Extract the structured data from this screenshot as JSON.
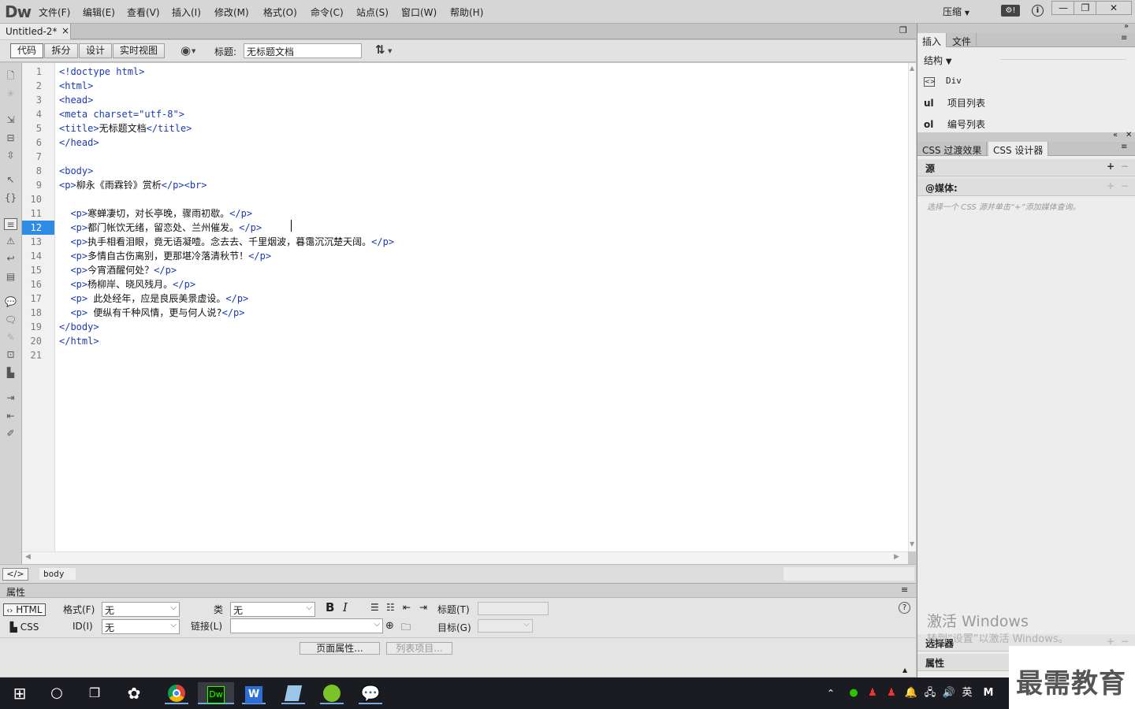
{
  "app": {
    "logo": "Dw",
    "menus": [
      "文件(F)",
      "编辑(E)",
      "查看(V)",
      "插入(I)",
      "修改(M)",
      "格式(O)",
      "命令(C)",
      "站点(S)",
      "窗口(W)",
      "帮助(H)"
    ],
    "compress": "压缩",
    "window_buttons": [
      "—",
      "❐",
      "✕"
    ]
  },
  "document": {
    "tab_name": "Untitled-2*",
    "tab_close": "×",
    "view_buttons": [
      "代码",
      "拆分",
      "设计",
      "实时视图"
    ],
    "title_label": "标题:",
    "title_value": "无标题文档"
  },
  "editor": {
    "current_line": 12,
    "lines": [
      {
        "n": "1",
        "html": "&lt;!doctype html&gt;"
      },
      {
        "n": "2",
        "html": "&lt;html&gt;"
      },
      {
        "n": "3",
        "html": "&lt;head&gt;"
      },
      {
        "n": "4",
        "html": "&lt;meta charset=\"utf-8\"&gt;"
      },
      {
        "n": "5",
        "html": "&lt;title&gt;无标题文档&lt;/title&gt;"
      },
      {
        "n": "6",
        "html": "&lt;/head&gt;"
      },
      {
        "n": "7",
        "html": ""
      },
      {
        "n": "8",
        "html": "&lt;body&gt;"
      },
      {
        "n": "9",
        "html": "&lt;p&gt;柳永《雨霖铃》赏析&lt;/p&gt;&lt;br&gt;"
      },
      {
        "n": "10",
        "html": ""
      },
      {
        "n": "11",
        "html": "  &lt;p&gt;寒蝉凄切，对长亭晚，骤雨初歇。&lt;/p&gt;"
      },
      {
        "n": "12",
        "html": "  &lt;p&gt;都门帐饮无绪，留恋处、兰州催发。&lt;/p&gt;"
      },
      {
        "n": "13",
        "html": "  &lt;p&gt;执手相看泪眼，竟无语凝噎。念去去、千里烟波，暮霭沉沉楚天阔。&lt;/p&gt;"
      },
      {
        "n": "14",
        "html": "  &lt;p&gt;多情自古伤离别，更那堪冷落清秋节！&lt;/p&gt;"
      },
      {
        "n": "15",
        "html": "  &lt;p&gt;今宵酒醒何处？&lt;/p&gt;"
      },
      {
        "n": "16",
        "html": "  &lt;p&gt;杨柳岸、晓风残月。&lt;/p&gt;"
      },
      {
        "n": "17",
        "html": "  &lt;p&gt; 此处经年，应是良辰美景虚设。&lt;/p&gt;"
      },
      {
        "n": "18",
        "html": "  &lt;p&gt; 便纵有千种风情，更与何人说?&lt;/p&gt;"
      },
      {
        "n": "19",
        "html": "&lt;/body&gt;"
      },
      {
        "n": "20",
        "html": "&lt;/html&gt;"
      },
      {
        "n": "21",
        "html": ""
      }
    ]
  },
  "statusbar": {
    "tag_selector_icon": "</>",
    "current_tag": "body"
  },
  "properties": {
    "title": "属性",
    "html_button": "HTML",
    "css_button": "CSS",
    "format_label": "格式(F)",
    "format_value": "无",
    "id_label": "ID(I)",
    "id_value": "无",
    "class_label": "类",
    "class_value": "无",
    "link_label": "链接(L)",
    "link_value": "",
    "bold": "B",
    "italic": "I",
    "heading_label": "标题(T)",
    "target_label": "目标(G)",
    "page_props_button": "页面属性...",
    "list_item_button": "列表项目..."
  },
  "right_panel": {
    "tabs_top": [
      "插入",
      "文件"
    ],
    "insert_category": "结构",
    "insert_items": [
      {
        "icon": "<>",
        "label": "Div"
      },
      {
        "icon": "ul",
        "label": "项目列表"
      },
      {
        "icon": "ol",
        "label": "编号列表"
      }
    ],
    "tabs_css": [
      "CSS 过渡效果",
      "CSS 设计器"
    ],
    "source_header": "源",
    "media_header": "@媒体:",
    "media_hint": "选择一个 CSS 源并单击“+”添加媒体查询。",
    "selector_header": "选择器",
    "property_header": "属性",
    "activate_title": "激活 Windows",
    "activate_sub": "转到“设置”以激活 Windows。"
  },
  "taskbar": {
    "ime": "英",
    "watermark": "最需教育"
  }
}
